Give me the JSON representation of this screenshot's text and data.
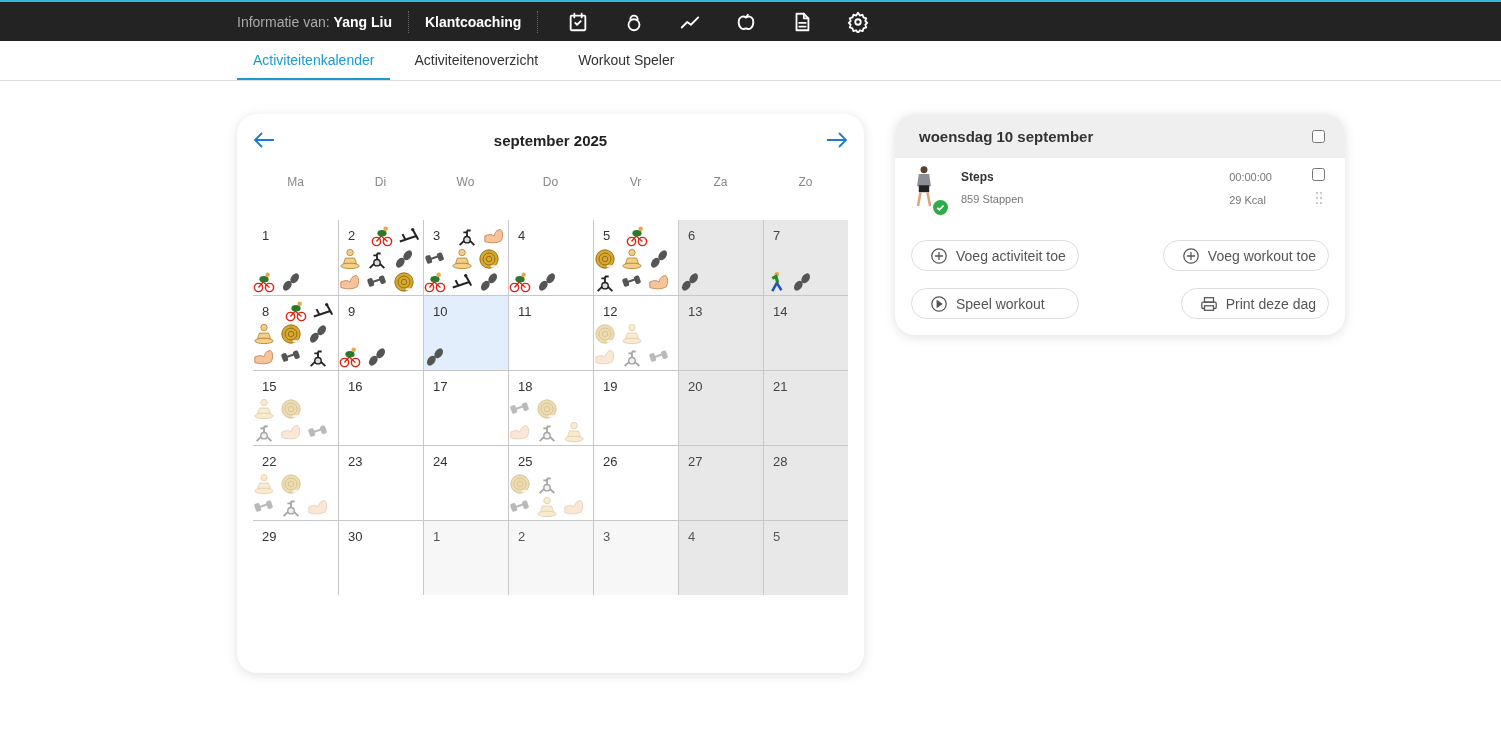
{
  "topbar": {
    "info_label": "Informatie van:",
    "client_name": "Yang Liu",
    "section": "Klantcoaching",
    "nav_icons": [
      {
        "kind": "calendar"
      },
      {
        "kind": "kettlebell"
      },
      {
        "kind": "trend"
      },
      {
        "kind": "apple"
      },
      {
        "kind": "document"
      },
      {
        "kind": "settings"
      }
    ]
  },
  "tabs": [
    {
      "label": "Activiteitenkalender",
      "selected": true
    },
    {
      "label": "Activiteitenoverzicht",
      "selected": false
    },
    {
      "label": "Workout Speler",
      "selected": false
    }
  ],
  "calendar": {
    "title": "september 2025",
    "weekdays": [
      "Ma",
      "Di",
      "Wo",
      "Do",
      "Vr",
      "Za",
      "Zo"
    ],
    "days": [
      {
        "day": "1",
        "current_month": true,
        "weekend": false,
        "selected": false,
        "planned": false,
        "activities": [
          {
            "kind": "cycling"
          },
          {
            "kind": "steps"
          }
        ]
      },
      {
        "day": "2",
        "current_month": true,
        "weekend": false,
        "selected": false,
        "planned": false,
        "activities": [
          {
            "kind": "cycling"
          },
          {
            "kind": "rowing"
          },
          {
            "kind": "yoga"
          },
          {
            "kind": "spinbike"
          },
          {
            "kind": "steps"
          },
          {
            "kind": "arm"
          },
          {
            "kind": "dumbbell"
          },
          {
            "kind": "rope"
          }
        ]
      },
      {
        "day": "3",
        "current_month": true,
        "weekend": false,
        "selected": false,
        "planned": false,
        "activities": [
          {
            "kind": "spinbike"
          },
          {
            "kind": "arm"
          },
          {
            "kind": "dumbbell"
          },
          {
            "kind": "yoga"
          },
          {
            "kind": "rope"
          },
          {
            "kind": "cycling"
          },
          {
            "kind": "rowing"
          },
          {
            "kind": "steps"
          }
        ]
      },
      {
        "day": "4",
        "current_month": true,
        "weekend": false,
        "selected": false,
        "planned": false,
        "activities": [
          {
            "kind": "cycling"
          },
          {
            "kind": "steps"
          }
        ]
      },
      {
        "day": "5",
        "current_month": true,
        "weekend": false,
        "selected": false,
        "planned": false,
        "activities": [
          {
            "kind": "cycling"
          },
          {
            "kind": "rope"
          },
          {
            "kind": "yoga"
          },
          {
            "kind": "steps"
          },
          {
            "kind": "spinbike"
          },
          {
            "kind": "dumbbell"
          },
          {
            "kind": "arm"
          }
        ]
      },
      {
        "day": "6",
        "current_month": true,
        "weekend": true,
        "selected": false,
        "planned": false,
        "activities": [
          {
            "kind": "steps"
          }
        ]
      },
      {
        "day": "7",
        "current_month": true,
        "weekend": true,
        "selected": false,
        "planned": false,
        "activities": [
          {
            "kind": "walking"
          },
          {
            "kind": "steps"
          }
        ]
      },
      {
        "day": "8",
        "current_month": true,
        "weekend": false,
        "selected": false,
        "planned": false,
        "activities": [
          {
            "kind": "cycling"
          },
          {
            "kind": "rowing"
          },
          {
            "kind": "yoga"
          },
          {
            "kind": "rope"
          },
          {
            "kind": "steps"
          },
          {
            "kind": "arm"
          },
          {
            "kind": "dumbbell"
          },
          {
            "kind": "spinbike"
          }
        ]
      },
      {
        "day": "9",
        "current_month": true,
        "weekend": false,
        "selected": false,
        "planned": false,
        "activities": [
          {
            "kind": "cycling"
          },
          {
            "kind": "steps"
          }
        ]
      },
      {
        "day": "10",
        "current_month": true,
        "weekend": false,
        "selected": true,
        "planned": false,
        "activities": [
          {
            "kind": "steps"
          }
        ]
      },
      {
        "day": "11",
        "current_month": true,
        "weekend": false,
        "selected": false
      },
      {
        "day": "12",
        "current_month": true,
        "weekend": false,
        "selected": false,
        "planned": true,
        "activities": [
          {
            "kind": "rope"
          },
          {
            "kind": "yoga"
          },
          {
            "kind": "arm"
          },
          {
            "kind": "spinbike"
          },
          {
            "kind": "dumbbell"
          }
        ]
      },
      {
        "day": "13",
        "current_month": true,
        "weekend": true,
        "selected": false
      },
      {
        "day": "14",
        "current_month": true,
        "weekend": true,
        "selected": false
      },
      {
        "day": "15",
        "current_month": true,
        "weekend": false,
        "selected": false,
        "planned": true,
        "activities": [
          {
            "kind": "yoga"
          },
          {
            "kind": "rope"
          },
          {
            "kind": "spinbike"
          },
          {
            "kind": "arm"
          },
          {
            "kind": "dumbbell"
          }
        ]
      },
      {
        "day": "16",
        "current_month": true,
        "weekend": false,
        "selected": false
      },
      {
        "day": "17",
        "current_month": true,
        "weekend": false,
        "selected": false
      },
      {
        "day": "18",
        "current_month": true,
        "weekend": false,
        "selected": false,
        "planned": true,
        "activities": [
          {
            "kind": "dumbbell"
          },
          {
            "kind": "rope"
          },
          {
            "kind": "arm"
          },
          {
            "kind": "spinbike"
          },
          {
            "kind": "yoga"
          }
        ]
      },
      {
        "day": "19",
        "current_month": true,
        "weekend": false,
        "selected": false
      },
      {
        "day": "20",
        "current_month": true,
        "weekend": true,
        "selected": false
      },
      {
        "day": "21",
        "current_month": true,
        "weekend": true,
        "selected": false
      },
      {
        "day": "22",
        "current_month": true,
        "weekend": false,
        "selected": false,
        "planned": true,
        "activities": [
          {
            "kind": "yoga"
          },
          {
            "kind": "rope"
          },
          {
            "kind": "dumbbell"
          },
          {
            "kind": "spinbike"
          },
          {
            "kind": "arm"
          }
        ]
      },
      {
        "day": "23",
        "current_month": true,
        "weekend": false,
        "selected": false
      },
      {
        "day": "24",
        "current_month": true,
        "weekend": false,
        "selected": false
      },
      {
        "day": "25",
        "current_month": true,
        "weekend": false,
        "selected": false,
        "planned": true,
        "activities": [
          {
            "kind": "rope"
          },
          {
            "kind": "spinbike"
          },
          {
            "kind": "dumbbell"
          },
          {
            "kind": "yoga"
          },
          {
            "kind": "arm"
          }
        ]
      },
      {
        "day": "26",
        "current_month": true,
        "weekend": false,
        "selected": false
      },
      {
        "day": "27",
        "current_month": true,
        "weekend": true,
        "selected": false
      },
      {
        "day": "28",
        "current_month": true,
        "weekend": true,
        "selected": false
      },
      {
        "day": "29",
        "current_month": true,
        "weekend": false,
        "selected": false
      },
      {
        "day": "30",
        "current_month": true,
        "weekend": false,
        "selected": false
      },
      {
        "day": "1",
        "current_month": false,
        "weekend": false,
        "selected": false
      },
      {
        "day": "2",
        "current_month": false,
        "weekend": false,
        "selected": false
      },
      {
        "day": "3",
        "current_month": false,
        "weekend": false,
        "selected": false
      },
      {
        "day": "4",
        "current_month": false,
        "weekend": true,
        "selected": false
      },
      {
        "day": "5",
        "current_month": false,
        "weekend": true,
        "selected": false
      }
    ]
  },
  "day_panel": {
    "title": "woensdag 10 september",
    "checked": false,
    "activities": [
      {
        "name": "Steps",
        "detail": "859 Stappen",
        "duration": "00:00:00",
        "calories": "29 Kcal",
        "completed": true,
        "checked": false
      }
    ],
    "buttons": [
      {
        "kind": "add",
        "label": "Voeg activiteit toe"
      },
      {
        "kind": "add",
        "label": "Voeg workout toe"
      },
      {
        "kind": "play",
        "label": "Speel workout"
      },
      {
        "kind": "print",
        "label": "Print deze dag"
      }
    ]
  }
}
